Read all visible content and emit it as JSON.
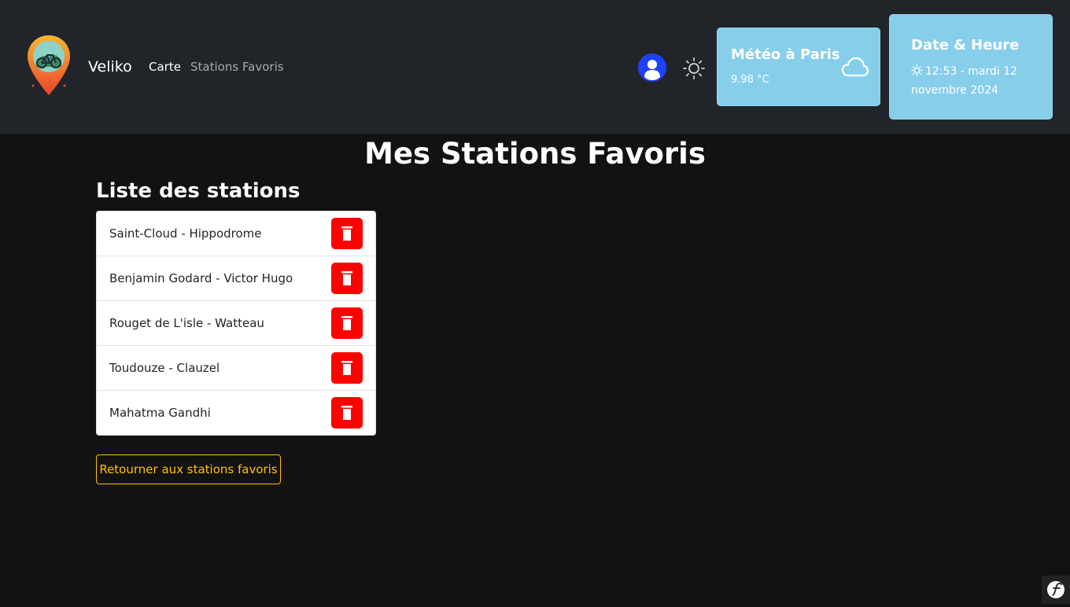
{
  "navbar": {
    "brand": "Veliko",
    "links": [
      {
        "label": "Carte",
        "active": true
      },
      {
        "label": "Stations Favoris",
        "active": false
      }
    ],
    "colors": {
      "background": "#212529"
    }
  },
  "weather": {
    "title": "Météo à Paris",
    "temperature": "9.98 °C",
    "icon": "cloud-icon",
    "background": "#87ceeb"
  },
  "datetime": {
    "title": "Date & Heure",
    "value": "12:53 - mardi 12 novembre 2024",
    "icon": "sun-icon",
    "background": "#87ceeb"
  },
  "page": {
    "title": "Mes Stations Favoris",
    "section_title": "Liste des stations",
    "back_button": "Retourner aux stations favoris"
  },
  "stations": [
    {
      "name": "Saint-Cloud - Hippodrome"
    },
    {
      "name": "Benjamin Godard - Victor Hugo"
    },
    {
      "name": "Rouget de L'isle - Watteau"
    },
    {
      "name": "Toudouze - Clauzel"
    },
    {
      "name": "Mahatma Gandhi"
    }
  ],
  "colors": {
    "page_background": "#121213",
    "delete_button": "#ff0000",
    "back_button_accent": "#ffc107",
    "avatar": "#1e40ff"
  }
}
